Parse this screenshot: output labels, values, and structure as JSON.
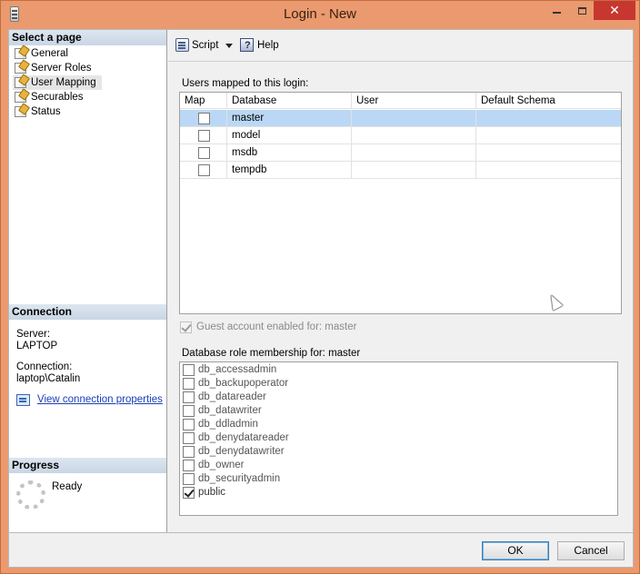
{
  "window": {
    "title": "Login - New",
    "close_glyph": "✕"
  },
  "left_pane": {
    "select_page_header": "Select a page",
    "pages": [
      {
        "label": "General",
        "selected": false
      },
      {
        "label": "Server Roles",
        "selected": false
      },
      {
        "label": "User Mapping",
        "selected": true
      },
      {
        "label": "Securables",
        "selected": false
      },
      {
        "label": "Status",
        "selected": false
      }
    ],
    "connection_header": "Connection",
    "server_label": "Server:",
    "server_value": "LAPTOP",
    "connection_label": "Connection:",
    "connection_value": "laptop\\Catalin",
    "view_connection_link": "View connection properties",
    "progress_header": "Progress",
    "progress_status": "Ready"
  },
  "toolbar": {
    "script_label": "Script",
    "help_label": "Help"
  },
  "mapping": {
    "section_label": "Users mapped to this login:",
    "columns": [
      "Map",
      "Database",
      "User",
      "Default Schema"
    ],
    "rows": [
      {
        "map": false,
        "database": "master",
        "user": "",
        "schema": "",
        "selected": true
      },
      {
        "map": false,
        "database": "model",
        "user": "",
        "schema": "",
        "selected": false
      },
      {
        "map": false,
        "database": "msdb",
        "user": "",
        "schema": "",
        "selected": false
      },
      {
        "map": false,
        "database": "tempdb",
        "user": "",
        "schema": "",
        "selected": false
      }
    ],
    "guest_label": "Guest account enabled for: master",
    "guest_checked": true
  },
  "roles": {
    "section_label": "Database role membership for: master",
    "items": [
      {
        "label": "db_accessadmin",
        "checked": false
      },
      {
        "label": "db_backupoperator",
        "checked": false
      },
      {
        "label": "db_datareader",
        "checked": false
      },
      {
        "label": "db_datawriter",
        "checked": false
      },
      {
        "label": "db_ddladmin",
        "checked": false
      },
      {
        "label": "db_denydatareader",
        "checked": false
      },
      {
        "label": "db_denydatawriter",
        "checked": false
      },
      {
        "label": "db_owner",
        "checked": false
      },
      {
        "label": "db_securityadmin",
        "checked": false
      },
      {
        "label": "public",
        "checked": true
      }
    ]
  },
  "footer": {
    "ok_label": "OK",
    "cancel_label": "Cancel"
  }
}
